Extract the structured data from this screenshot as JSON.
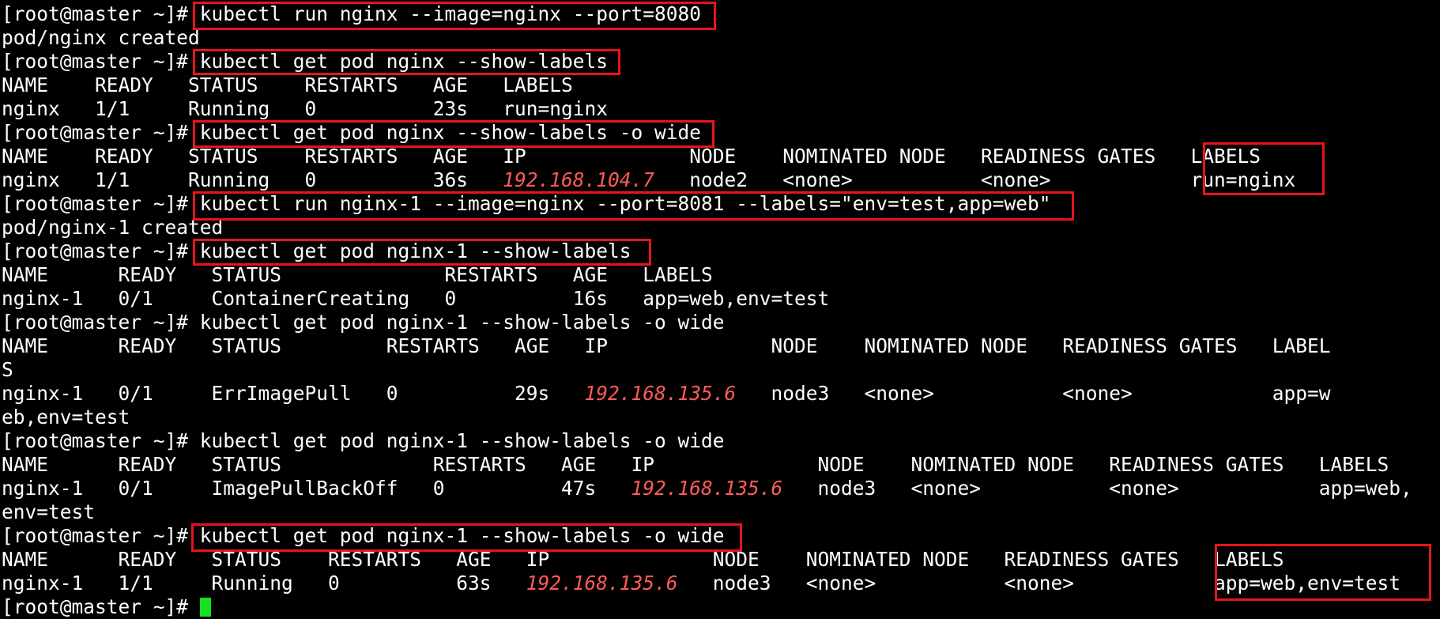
{
  "terminal": {
    "prompt": "[root@master ~]# ",
    "colors": {
      "background": "#000000",
      "text": "#ffffff",
      "ip": "#ff5a5a",
      "highlight_box": "#e8141b",
      "cursor": "#17e020"
    },
    "lines": {
      "l00": "kubectl run nginx --image=nginx --port=8080",
      "l01": "pod/nginx created",
      "l02": "kubectl get pod nginx --show-labels",
      "l03": "NAME    READY   STATUS    RESTARTS   AGE   LABELS",
      "l04": "nginx   1/1     Running   0          23s   run=nginx",
      "l05": "kubectl get pod nginx --show-labels -o wide",
      "l06": "NAME    READY   STATUS    RESTARTS   AGE   IP              NODE    NOMINATED NODE   READINESS GATES   LABELS",
      "l07a": "nginx   1/1     Running   0          36s   ",
      "l07ip": "192.168.104.7",
      "l07b": "   node2   <none>           <none>            run=nginx",
      "l08": "kubectl run nginx-1 --image=nginx --port=8081 --labels=\"env=test,app=web\"",
      "l09": "pod/nginx-1 created",
      "l10": "kubectl get pod nginx-1 --show-labels",
      "l11": "NAME      READY   STATUS              RESTARTS   AGE   LABELS",
      "l12": "nginx-1   0/1     ContainerCreating   0          16s   app=web,env=test",
      "l13": "kubectl get pod nginx-1 --show-labels -o wide",
      "l14": "NAME      READY   STATUS         RESTARTS   AGE   IP              NODE    NOMINATED NODE   READINESS GATES   LABEL",
      "l15": "S",
      "l16a": "nginx-1   0/1     ErrImagePull   0          29s   ",
      "l16ip": "192.168.135.6",
      "l16b": "   node3   <none>           <none>            app=w",
      "l17": "eb,env=test",
      "l18": "kubectl get pod nginx-1 --show-labels -o wide",
      "l19": "NAME      READY   STATUS             RESTARTS   AGE   IP              NODE    NOMINATED NODE   READINESS GATES   LABELS",
      "l20a": "nginx-1   0/1     ImagePullBackOff   0          47s   ",
      "l20ip": "192.168.135.6",
      "l20b": "   node3   <none>           <none>            app=web,",
      "l21": "env=test",
      "l22": "kubectl get pod nginx-1 --show-labels -o wide",
      "l23": "NAME      READY   STATUS    RESTARTS   AGE   IP              NODE    NOMINATED NODE   READINESS GATES   LABELS",
      "l24a": "nginx-1   1/1     Running   0          63s   ",
      "l24ip": "192.168.135.6",
      "l24b": "   node3   <none>           <none>            app=web,env=test"
    }
  }
}
